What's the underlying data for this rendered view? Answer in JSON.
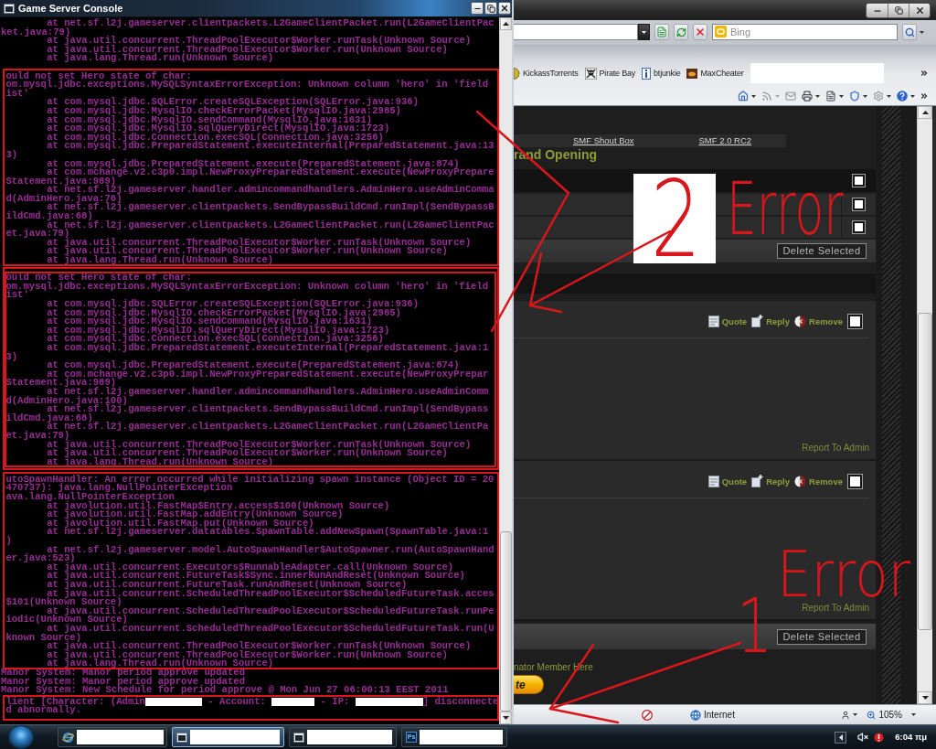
{
  "console_window": {
    "title": "Game Server Console",
    "blocks": [
      {
        "separated": false,
        "kind": "plain",
        "lines": [
          {
            "text": "at net.sf.l2j.gameserver.clientpackets.L2GameClientPacket.run(L2GameClientPac",
            "indented": true
          },
          {
            "text": "ket.java:79)",
            "indented": false
          },
          {
            "text": "at java.util.concurrent.ThreadPoolExecutor$Worker.runTask(Unknown Source)",
            "indented": true
          },
          {
            "text": "at java.util.concurrent.ThreadPoolExecutor$Worker.run(Unknown Source)",
            "indented": true
          },
          {
            "text": "at java.lang.Thread.run(Unknown Source)",
            "indented": true
          }
        ]
      },
      {
        "separated": true,
        "kind": "boxed",
        "lines": [
          {
            "text": "ould not set Hero state of char:",
            "indented": false
          },
          {
            "text": "om.mysql.jdbc.exceptions.MySQLSyntaxErrorException: Unknown column 'hero' in 'field",
            "indented": false
          },
          {
            "text": "ist'",
            "indented": false
          },
          {
            "text": "at com.mysql.jdbc.SQLError.createSQLException(SQLError.java:936)",
            "indented": true
          },
          {
            "text": "at com.mysql.jdbc.MysqlIO.checkErrorPacket(MysqlIO.java:2985)",
            "indented": true
          },
          {
            "text": "at com.mysql.jdbc.MysqlIO.sendCommand(MysqlIO.java:1631)",
            "indented": true
          },
          {
            "text": "at com.mysql.jdbc.MysqlIO.sqlQueryDirect(MysqlIO.java:1723)",
            "indented": true
          },
          {
            "text": "at com.mysql.jdbc.Connection.execSQL(Connection.java:3256)",
            "indented": true
          },
          {
            "text": "at com.mysql.jdbc.PreparedStatement.executeInternal(PreparedStatement.java:13",
            "indented": true
          },
          {
            "text": "3)",
            "indented": false
          },
          {
            "text": "at com.mysql.jdbc.PreparedStatement.execute(PreparedStatement.java:874)",
            "indented": true
          },
          {
            "text": "at com.mchange.v2.c3p0.impl.NewProxyPreparedStatement.execute(NewProxyPrepare",
            "indented": true
          },
          {
            "text": "Statement.java:989)",
            "indented": false
          },
          {
            "text": "at net.sf.l2j.gameserver.handler.admincommandhandlers.AdminHero.useAdminComma",
            "indented": true
          },
          {
            "text": "d(AdminHero.java:76)",
            "indented": false
          },
          {
            "text": "at net.sf.l2j.gameserver.clientpackets.SendBypassBuildCmd.runImpl(SendBypassB",
            "indented": true
          },
          {
            "text": "ildCmd.java:68)",
            "indented": false
          },
          {
            "text": "at net.sf.l2j.gameserver.clientpackets.L2GameClientPacket.run(L2GameClientPac",
            "indented": true
          },
          {
            "text": "et.java:79)",
            "indented": false
          },
          {
            "text": "at java.util.concurrent.ThreadPoolExecutor$Worker.runTask(Unknown Source)",
            "indented": true
          },
          {
            "text": "at java.util.concurrent.ThreadPoolExecutor$Worker.run(Unknown Source)",
            "indented": true
          },
          {
            "text": "at java.lang.Thread.run(Unknown Source)",
            "indented": true
          }
        ]
      },
      {
        "separated": true,
        "kind": "doubled",
        "lines": [
          {
            "text": "ould not set Hero state of char:",
            "indented": false
          },
          {
            "text": "om.mysql.jdbc.exceptions.MySQLSyntaxErrorException: Unknown column 'hero' in 'field",
            "indented": false
          },
          {
            "text": "ist'",
            "indented": false
          },
          {
            "text": "at com.mysql.jdbc.SQLError.createSQLException(SQLError.java:936)",
            "indented": true
          },
          {
            "text": "at com.mysql.jdbc.MysqlIO.checkErrorPacket(MysqlIO.java:2985)",
            "indented": true
          },
          {
            "text": "at com.mysql.jdbc.MysqlIO.sendCommand(MysqlIO.java:1631)",
            "indented": true
          },
          {
            "text": "at com.mysql.jdbc.MysqlIO.sqlQueryDirect(MysqlIO.java:1723)",
            "indented": true
          },
          {
            "text": "at com.mysql.jdbc.Connection.execSQL(Connection.java:3256)",
            "indented": true
          },
          {
            "text": "at com.mysql.jdbc.PreparedStatement.executeInternal(PreparedStatement.java:1",
            "indented": true
          },
          {
            "text": "3)",
            "indented": false
          },
          {
            "text": "at com.mysql.jdbc.PreparedStatement.execute(PreparedStatement.java:874)",
            "indented": true
          },
          {
            "text": "at com.mchange.v2.c3p0.impl.NewProxyPreparedStatement.execute(NewProxyPrepar",
            "indented": true
          },
          {
            "text": "Statement.java:989)",
            "indented": false
          },
          {
            "text": "at net.sf.l2j.gameserver.handler.admincommandhandlers.AdminHero.useAdminComm",
            "indented": true
          },
          {
            "text": "d(AdminHero.java:100)",
            "indented": false
          },
          {
            "text": "at net.sf.l2j.gameserver.clientpackets.SendBypassBuildCmd.runImpl(SendBypass",
            "indented": true
          },
          {
            "text": "ildCmd.java:68)",
            "indented": false
          },
          {
            "text": "at net.sf.l2j.gameserver.clientpackets.L2GameClientPacket.run(L2GameClientPa",
            "indented": true
          },
          {
            "text": "et.java:79)",
            "indented": false
          },
          {
            "text": "at java.util.concurrent.ThreadPoolExecutor$Worker.runTask(Unknown Source)",
            "indented": true
          },
          {
            "text": "at java.util.concurrent.ThreadPoolExecutor$Worker.run(Unknown Source)",
            "indented": true
          },
          {
            "text": "at java.lang.Thread.run(Unknown Source)",
            "indented": true
          }
        ]
      },
      {
        "separated": true,
        "kind": "boxed",
        "lines": [
          {
            "text": "utoSpawnHandler: An error occurred while initializing spawn instance (Object ID = 20",
            "indented": false
          },
          {
            "text": "470737): java.lang.NullPointerException",
            "indented": false
          },
          {
            "text": "ava.lang.NullPointerException",
            "indented": false
          },
          {
            "text": "at javolution.util.FastMap$Entry.access$100(Unknown Source)",
            "indented": true
          },
          {
            "text": "at javolution.util.FastMap.addEntry(Unknown Source)",
            "indented": true
          },
          {
            "text": "at javolution.util.FastMap.put(Unknown Source)",
            "indented": true
          },
          {
            "text": "at net.sf.l2j.gameserver.datatables.SpawnTable.addNewSpawn(SpawnTable.java:1",
            "indented": true
          },
          {
            "text": ")",
            "indented": false
          },
          {
            "text": "at net.sf.l2j.gameserver.model.AutoSpawnHandler$AutoSpawner.run(AutoSpawnHand",
            "indented": true
          },
          {
            "text": "er.java:523)",
            "indented": false
          },
          {
            "text": "at java.util.concurrent.Executors$RunnableAdapter.call(Unknown Source)",
            "indented": true
          },
          {
            "text": "at java.util.concurrent.FutureTask$Sync.innerRunAndReset(Unknown Source)",
            "indented": true
          },
          {
            "text": "at java.util.concurrent.FutureTask.runAndReset(Unknown Source)",
            "indented": true
          },
          {
            "text": "at java.util.concurrent.ScheduledThreadPoolExecutor$ScheduledFutureTask.acces",
            "indented": true
          },
          {
            "text": "$101(Unknown Source)",
            "indented": false
          },
          {
            "text": "at java.util.concurrent.ScheduledThreadPoolExecutor$ScheduledFutureTask.runPe",
            "indented": true
          },
          {
            "text": "iodic(Unknown Source)",
            "indented": false
          },
          {
            "text": "at java.util.concurrent.ScheduledThreadPoolExecutor$ScheduledFutureTask.run(U",
            "indented": true
          },
          {
            "text": "known Source)",
            "indented": false
          },
          {
            "text": "at java.util.concurrent.ThreadPoolExecutor$Worker.runTask(Unknown Source)",
            "indented": true
          },
          {
            "text": "at java.util.concurrent.ThreadPoolExecutor$Worker.run(Unknown Source)",
            "indented": true
          },
          {
            "text": "at java.lang.Thread.run(Unknown Source)",
            "indented": true
          }
        ]
      },
      {
        "separated": false,
        "kind": "plain",
        "lines": [
          {
            "text": "Manor System: Manor period approve updated",
            "indented": false
          },
          {
            "text": "Manor System: Manor period approve updated",
            "indented": false
          },
          {
            "text": "Manor System: New Schedule for period approve @ Mon Jun 27 06:00:13 EEST 2011",
            "indented": false
          }
        ]
      },
      {
        "separated": false,
        "kind": "boxed",
        "lines": [
          {
            "indented": false,
            "segments": [
              {
                "kind": "text",
                "text": "lient [Character: (Admin"
              },
              {
                "kind": "redacted"
              },
              {
                "kind": "text",
                "text": " - Account: "
              },
              {
                "kind": "redacted"
              },
              {
                "kind": "text",
                "text": " - IP: "
              },
              {
                "kind": "redacted"
              },
              {
                "kind": "text",
                "text": "] disconnecte"
              }
            ]
          },
          {
            "text": "d abnormally.",
            "indented": false
          }
        ]
      }
    ]
  },
  "browser": {
    "search": {
      "placeholder": "Bing"
    },
    "favorites": [
      {
        "label": "KickassTorrents"
      },
      {
        "label": "Pirate Bay"
      },
      {
        "label": "btjunkie"
      },
      {
        "label": "MaxCheater"
      }
    ],
    "page": {
      "nav_links": [
        "SMF Shout Box",
        "SMF 2.0 RC2"
      ],
      "title": "rand Opening",
      "message_table": {
        "header": {
          "checked": false
        },
        "rows": [
          {
            "checked": false
          },
          {
            "checked": false
          }
        ],
        "delete_button": "Delete Selected"
      },
      "posts": [
        {
          "actions": [
            {
              "kind": "quote",
              "label": "Quote"
            },
            {
              "kind": "reply",
              "label": "Reply"
            },
            {
              "kind": "remove",
              "label": "Remove"
            }
          ],
          "checked": false,
          "report_link": "Report To Admin"
        },
        {
          "actions": [
            {
              "kind": "quote",
              "label": "Quote"
            },
            {
              "kind": "reply",
              "label": "Reply"
            },
            {
              "kind": "remove",
              "label": "Remove"
            }
          ],
          "checked": false,
          "report_link": "Report To Admin"
        }
      ],
      "bottom_bar": {
        "delete_button": "Delete Selected"
      },
      "footer_text": "nator Member Here",
      "footer_button": "te"
    },
    "status_bar": {
      "zone": "Internet",
      "zoom": "105%"
    }
  },
  "taskbar": {
    "buttons": [
      {
        "active": false
      },
      {
        "active": true
      },
      {
        "active": false
      },
      {
        "active": false,
        "badge": "Ps"
      }
    ],
    "clock": "6:04 πμ"
  },
  "annotations": [
    {
      "label": "2"
    },
    {
      "label": "Error"
    },
    {
      "label": "1"
    },
    {
      "label": "Error"
    }
  ]
}
